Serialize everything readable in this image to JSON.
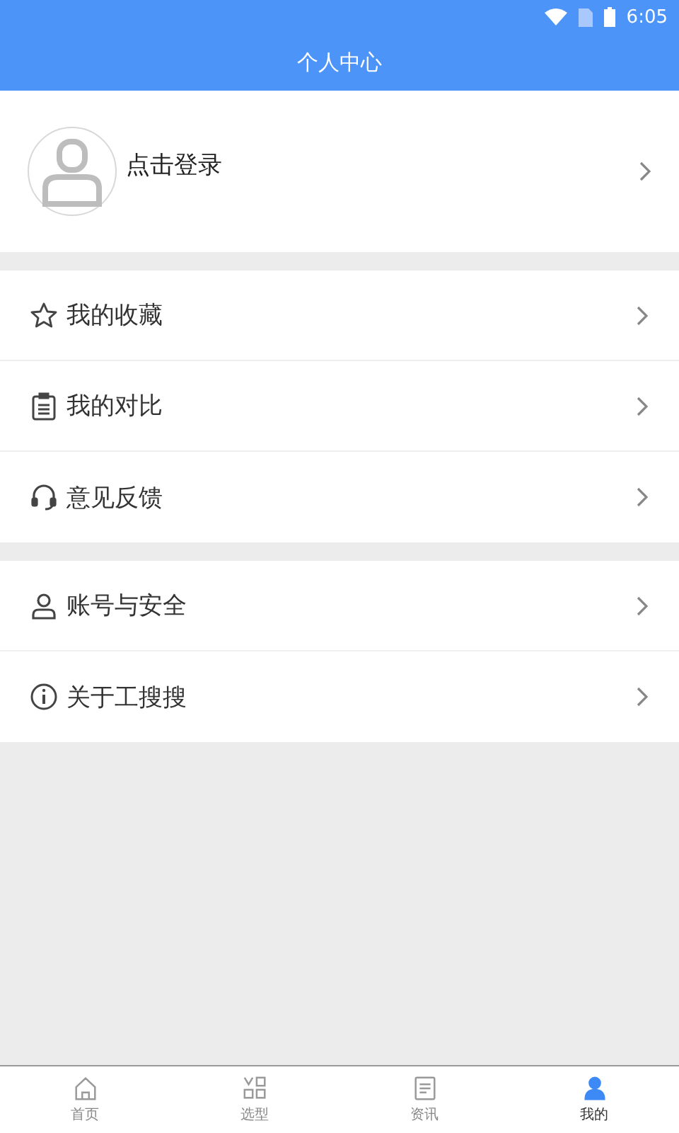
{
  "status_bar": {
    "time": "6:05"
  },
  "title": "个人中心",
  "profile": {
    "login_text": "点击登录"
  },
  "menu_groups": [
    {
      "items": [
        {
          "label": "我的收藏"
        },
        {
          "label": "我的对比"
        },
        {
          "label": "意见反馈"
        }
      ]
    },
    {
      "items": [
        {
          "label": "账号与安全"
        },
        {
          "label": "关于工搜搜"
        }
      ]
    }
  ],
  "tabs": [
    {
      "label": "首页",
      "selected": false
    },
    {
      "label": "选型",
      "selected": false
    },
    {
      "label": "资讯",
      "selected": false
    },
    {
      "label": "我的",
      "selected": true
    }
  ]
}
